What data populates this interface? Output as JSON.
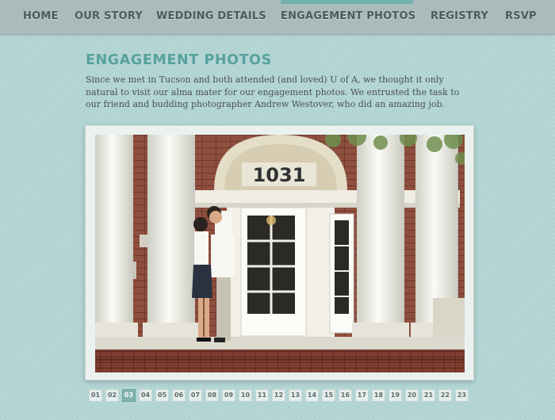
{
  "nav": {
    "items": [
      {
        "label": "HOME"
      },
      {
        "label": "OUR STORY"
      },
      {
        "label": "WEDDING DETAILS"
      },
      {
        "label": "ENGAGEMENT PHOTOS"
      },
      {
        "label": "REGISTRY"
      },
      {
        "label": "RSVP"
      }
    ],
    "active_index": 3
  },
  "page": {
    "title": "ENGAGEMENT PHOTOS",
    "intro": "Since we met in Tucson and both attended (and loved) U of A, we thought it only natural to visit our alma mater for our engagement photos. We entrusted the task to our friend and budding photographer Andrew Westover, who did an amazing job."
  },
  "photo": {
    "building_number": "1031"
  },
  "pager": {
    "pages": [
      "01",
      "02",
      "03",
      "04",
      "05",
      "06",
      "07",
      "08",
      "09",
      "10",
      "11",
      "12",
      "13",
      "14",
      "15",
      "16",
      "17",
      "18",
      "19",
      "20",
      "21",
      "22",
      "23"
    ],
    "active_index": 2
  },
  "colors": {
    "background": "#b3d6d5",
    "nav_bar": "#a9bcba",
    "accent": "#58a19d",
    "active_page": "#7fb3af"
  }
}
